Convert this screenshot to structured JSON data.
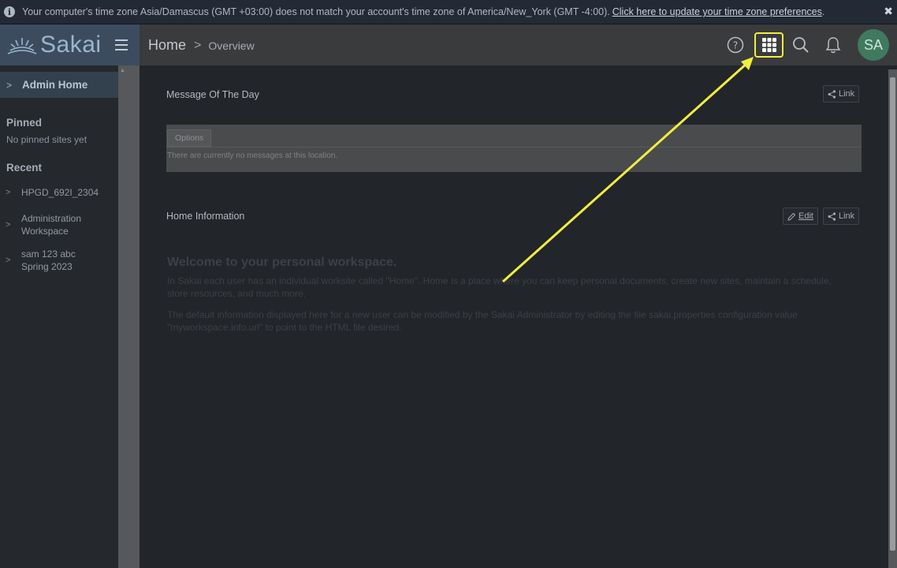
{
  "banner": {
    "message": "Your computer's time zone Asia/Damascus (GMT +03:00) does not match your account's time zone of America/New_York (GMT -4:00).",
    "link_text": "Click here to update your time zone preferences",
    "link_suffix": ".",
    "close_symbol": "✖"
  },
  "header": {
    "logo_text": "Sakai",
    "breadcrumb": {
      "home": "Home",
      "separator": ">",
      "current": "Overview"
    },
    "icons": [
      "help-icon",
      "apps-grid-icon",
      "search-icon",
      "bell-icon"
    ],
    "avatar_initials": "SA"
  },
  "sidebar": {
    "admin_home": "Admin Home",
    "pinned_title": "Pinned",
    "pinned_empty": "No pinned sites yet",
    "recent_title": "Recent",
    "recent_items": [
      {
        "line1": "HPGD_692I_2304",
        "line2": ""
      },
      {
        "line1": "Administration",
        "line2": "Workspace"
      },
      {
        "line1": "sam 123 abc",
        "line2": "Spring 2023"
      }
    ]
  },
  "main": {
    "motd": {
      "title": "Message Of The Day",
      "link_label": "Link",
      "options_label": "Options",
      "empty_text": "There are currently no messages at this location."
    },
    "home_info": {
      "title": "Home Information",
      "edit_label": "Edit",
      "link_label": "Link",
      "welcome_heading": "Welcome to your personal workspace.",
      "para1": "In Sakai each user has an individual worksite called \"Home\". Home is a place where you can keep personal documents, create new sites, maintain a schedule, store resources, and much more.",
      "para2": "The default information displayed here for a new user can be modified by the Sakai Administrator by editing the file sakai.properties configuration value \"myworkspace.info.url\" to point to the HTML file desired."
    }
  },
  "colors": {
    "highlight": "#f1ee3e",
    "avatar_bg": "#3f7a5e",
    "logo_area_bg": "#3c4c5e"
  }
}
